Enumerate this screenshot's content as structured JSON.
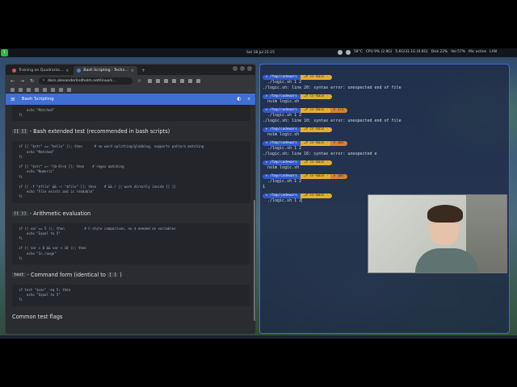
{
  "topbar": {
    "workspace": "1",
    "clock": "Sat 18 Jul 21:15",
    "tray": [
      "58°C",
      "CPU 9% (2.9G)",
      "5.6G/31.1G (0.6G)",
      "Disk 22%",
      "Vol 57%",
      "Mic active",
      "LAN"
    ]
  },
  "browser": {
    "tabs": [
      {
        "title": "Training on Quadrants...",
        "active": false
      },
      {
        "title": "Bash Scripting - Techn...",
        "active": true
      }
    ],
    "url": "docs.alexanderlindholm.net/linux/s...",
    "page_header": "Bash Scripting",
    "content": {
      "block0": [
        "    echo \"Matched\"",
        "fi"
      ],
      "heading1_code": "[[ ]]",
      "heading1_text": " - Bash extended test (recommended in bash scripts)",
      "block1": [
        "if [[ \"$str\" == \"hello\" ]]; then      # no word splitting/globbing, supports pattern matching",
        "    echo \"Matched\"",
        "fi",
        "",
        "if [[ \"$str\" =~ ^[0-9]+$ ]]; then    # regex matching",
        "    echo \"Numeric\"",
        "fi",
        "",
        "if [[ -f \"$file\" && -r \"$file\" ]]; then    # && / || work directly inside [[ ]]",
        "    echo \"File exists and is readable\"",
        "fi"
      ],
      "heading2_code": "(( ))",
      "heading2_text": " - Arithmetic evaluation",
      "block2": [
        "if (( var == 5 )); then          # C-style comparison, no $ needed on variables",
        "    echo \"Equal to 5\"",
        "fi",
        "",
        "if (( var > 0 && var < 10 )); then",
        "    echo \"In range\"",
        "fi"
      ],
      "heading3_code": "test",
      "heading3_text": " - Command form (identical to ",
      "heading3_code2": "[ ]",
      "heading3_tail": ")",
      "block3": [
        "if test \"$var\" -eq 5; then",
        "    echo \"Equal to 5\"",
        "fi"
      ],
      "heading4": "Common test flags"
    }
  },
  "terminal": {
    "prompt_dir": "/tmp/codewars",
    "git_branch": "⎇ cs-main -",
    "lines": [
      {
        "type": "prompt"
      },
      {
        "type": "cmd",
        "text": "./logic.sh 1 2"
      },
      {
        "type": "err",
        "text": "./logic.sh: line 20: syntax error: unexpected end of file"
      },
      {
        "type": "prompt"
      },
      {
        "type": "cmd",
        "text": "nvim logic.sh"
      },
      {
        "type": "prompt",
        "exit": "✗ 1?s"
      },
      {
        "type": "cmd",
        "text": "./logic.sh 1 2"
      },
      {
        "type": "err",
        "text": "./logic.sh: line 10: syntax error: unexpected end of file"
      },
      {
        "type": "prompt"
      },
      {
        "type": "cmd",
        "text": "nvim logic.sh"
      },
      {
        "type": "prompt",
        "exit": "✗ 1ms"
      },
      {
        "type": "cmd",
        "text": "./logic.sh 1 2"
      },
      {
        "type": "err",
        "text": "./logic.sh: line 16: syntax error: unexpected e"
      },
      {
        "type": "prompt"
      },
      {
        "type": "cmd",
        "text": "nvim logic.sh"
      },
      {
        "type": "prompt",
        "exit": "✗ 1ms"
      },
      {
        "type": "cmd",
        "text": "./logic.sh 1 2"
      },
      {
        "type": "out",
        "text": "1"
      },
      {
        "type": "prompt"
      },
      {
        "type": "cmd",
        "text": "./logic.sh 1 2"
      }
    ]
  }
}
